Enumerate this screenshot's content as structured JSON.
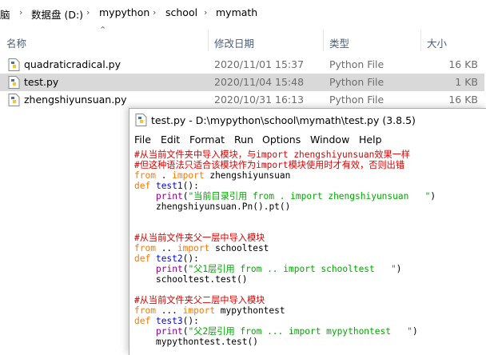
{
  "breadcrumb": {
    "items": [
      "脑",
      "数据盘 (D:)",
      "mypython",
      "school",
      "mymath"
    ],
    "separator": "›"
  },
  "columns": {
    "name": "名称",
    "date": "修改日期",
    "type": "类型",
    "size": "大小"
  },
  "files": [
    {
      "name": "quadraticradical.py",
      "date": "2020/11/01 15:37",
      "type": "Python File",
      "size": "16 KB",
      "selected": false
    },
    {
      "name": "test.py",
      "date": "2020/11/04 15:48",
      "type": "Python File",
      "size": "1 KB",
      "selected": true
    },
    {
      "name": "zhengshiyunsuan.py",
      "date": "2020/10/31 16:13",
      "type": "Python File",
      "size": "16 KB",
      "selected": false
    }
  ],
  "idle": {
    "title": "test.py - D:\\mypython\\school\\mymath\\test.py (3.8.5)",
    "menu": [
      "File",
      "Edit",
      "Format",
      "Run",
      "Options",
      "Window",
      "Help"
    ],
    "code": {
      "l1": "#从当前文件夹中导入模块，与import zhengshiyunsuan效果一样",
      "l2": "#但这种语法只适合该模块作为import模块使用时才有效，否则出错",
      "l3_kw1": "from",
      "l3_mid": " . ",
      "l3_kw2": "import",
      "l3_rest": " zhengshiyunsuan",
      "l4_kw": "def",
      "l4_fn": " test1",
      "l4_rest": "():",
      "l5_b": "print",
      "l5_p1": "(",
      "l5_s": "\"当前目录引用 from . import zhengshiyunsuan   \"",
      "l5_p2": ")",
      "l6": "zhengshiyunsuan.Pn().pt()",
      "l7": "#从当前文件夹父一层中导入模块",
      "l8_kw1": "from",
      "l8_mid": " .. ",
      "l8_kw2": "import",
      "l8_rest": " schooltest",
      "l9_kw": "def",
      "l9_fn": " test2",
      "l9_rest": "():",
      "l10_b": "print",
      "l10_p1": "(",
      "l10_s": "\"父1层引用 from .. import schooltest   \"",
      "l10_p2": ")",
      "l11": "schooltest.test()",
      "l12": "#从当前文件夹父二层中导入模块",
      "l13_kw1": "from",
      "l13_mid": " ... ",
      "l13_kw2": "import",
      "l13_rest": " mypythontest",
      "l14_kw": "def",
      "l14_fn": " test3",
      "l14_rest": "():",
      "l15_b": "print",
      "l15_p1": "(",
      "l15_s": "\"父2层引用 from ... import mypythontest   \"",
      "l15_p2": ")",
      "l16": "mypythontest.test()"
    }
  }
}
